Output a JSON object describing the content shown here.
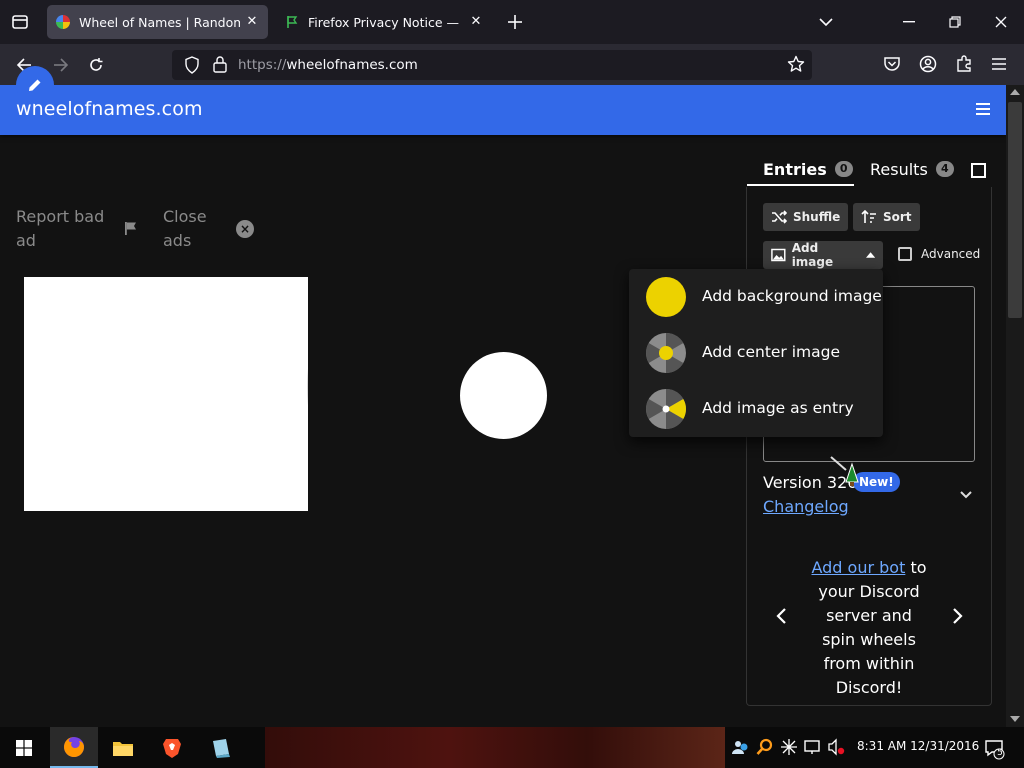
{
  "browser": {
    "tabs": [
      {
        "title": "Wheel of Names | Random nam",
        "active": true
      },
      {
        "title": "Firefox Privacy Notice — Mozill",
        "active": false
      }
    ],
    "url_scheme": "https://",
    "url_host": "wheelofnames.com"
  },
  "app": {
    "brand": "wheelofnames.com",
    "accent_color": "#3369e8"
  },
  "ads": {
    "report_line1": "Report bad",
    "report_line2": "ad",
    "close_line1": "Close",
    "close_line2": "ads"
  },
  "sidebar": {
    "tabs": [
      {
        "label": "Entries",
        "count": "0"
      },
      {
        "label": "Results",
        "count": "4"
      }
    ],
    "shuffle_label": "Shuffle",
    "sort_label": "Sort",
    "add_image_label": "Add image",
    "advanced_label": "Advanced",
    "version_text": "Version 326",
    "new_badge": "New!",
    "changelog_label": "Changelog",
    "promo": {
      "link_text": "Add our bot",
      "rest_text": " to your Discord server and spin wheels from within Discord!"
    }
  },
  "image_menu": {
    "items": [
      {
        "label": "Add background image",
        "icon": "background-image-icon"
      },
      {
        "label": "Add center image",
        "icon": "center-image-icon"
      },
      {
        "label": "Add image as entry",
        "icon": "entry-image-icon"
      }
    ]
  },
  "taskbar": {
    "clock": "8:31 AM 12/31/2016",
    "notification_count": "5"
  }
}
